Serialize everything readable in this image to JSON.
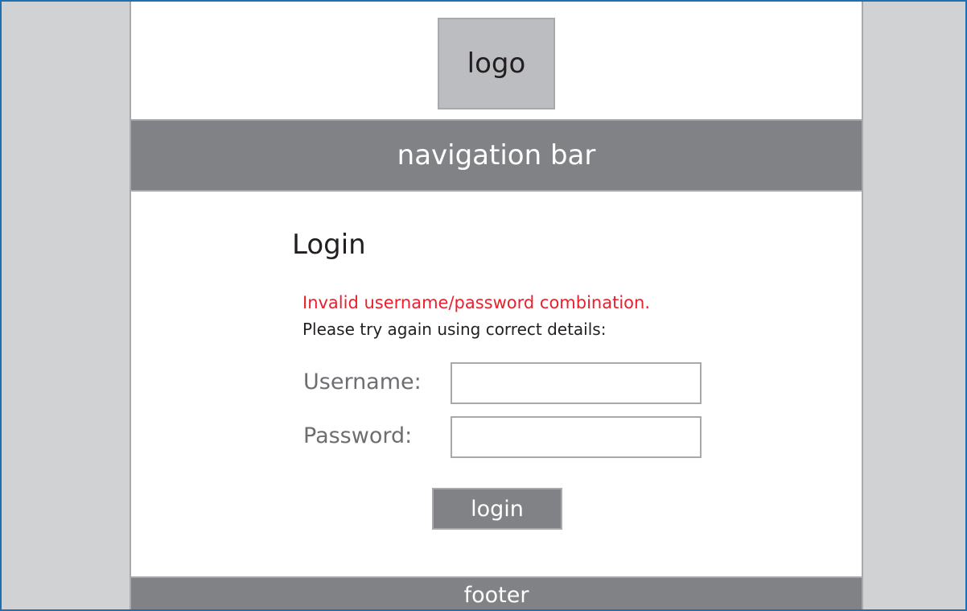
{
  "header": {
    "logo_text": "logo"
  },
  "nav": {
    "label": "navigation bar"
  },
  "login": {
    "title": "Login",
    "error_message": "Invalid username/password combination.",
    "hint_message": "Please try again using correct details:",
    "username_label": "Username:",
    "username_value": "",
    "password_label": "Password:",
    "password_value": "",
    "button_label": "login"
  },
  "footer": {
    "label": "footer"
  },
  "colors": {
    "frame_border": "#1f6fb4",
    "side_background": "#d0d2d4",
    "bar_gray": "#808285",
    "logo_gray": "#bcbdc0",
    "error_red": "#e8202f"
  }
}
